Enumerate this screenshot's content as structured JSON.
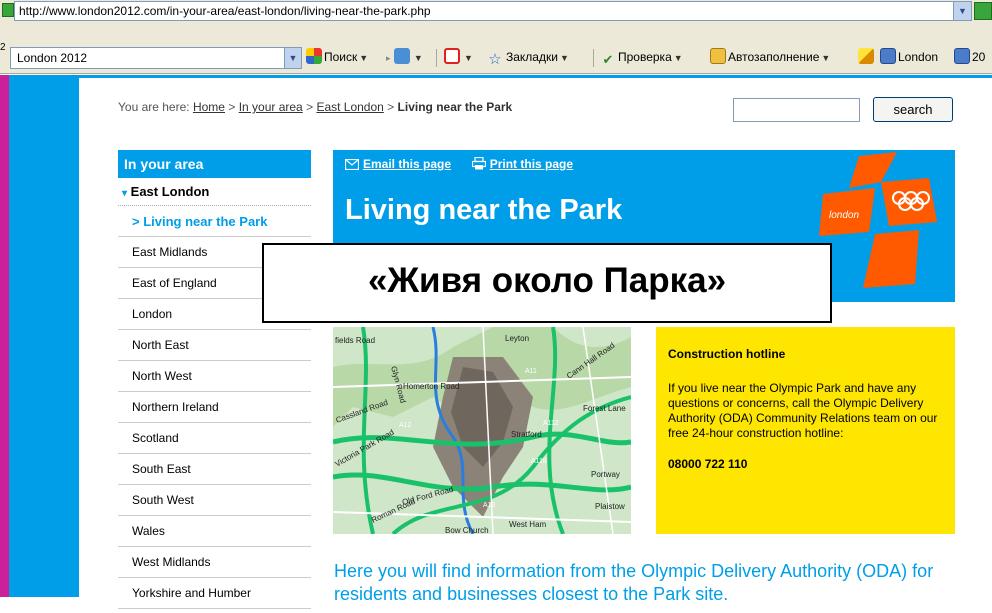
{
  "browser": {
    "address_url": "http://www.london2012.com/in-your-area/east-london/living-near-the-park.php",
    "toolbar_number": "2",
    "toolbar_search_value": "London 2012",
    "toolbar": {
      "search_label": "Поиск",
      "bookmarks_label": "Закладки",
      "spellcheck_label": "Проверка",
      "autofill_label": "Автозаполнение",
      "london_label": "London",
      "truncated_label": "20"
    }
  },
  "breadcrumb": {
    "prefix": "You are here:",
    "home": "Home",
    "in_your_area": "In your area",
    "east_london": "East London",
    "current": "Living near the Park",
    "separator": ">"
  },
  "site_search": {
    "button_label": "search",
    "value": ""
  },
  "leftnav": {
    "heading": "In your area",
    "parent": "East London",
    "current": "> Living near the Park",
    "items": [
      "East Midlands",
      "East of England",
      "London",
      "North East",
      "North West",
      "Northern Ireland",
      "Scotland",
      "South East",
      "South West",
      "Wales",
      "West Midlands",
      "Yorkshire and Humber"
    ]
  },
  "header": {
    "email_link": "Email this page",
    "print_link": "Print this page",
    "title": "Living near the Park",
    "logo_text": "london"
  },
  "overlay": {
    "caption": "«Живя около Парка»"
  },
  "map": {
    "labels": [
      "fields Road",
      "Glyn Road",
      "Homerton Road",
      "Leyton",
      "Cann Hall Road",
      "Forest Lane",
      "Cassland Road",
      "A12",
      "A11",
      "A112",
      "A118",
      "Stratford",
      "Portway",
      "Plaistow",
      "Old Ford Road",
      "Roman Road",
      "West Ham",
      "Victoria Park Road",
      "Bow Church",
      "A13"
    ]
  },
  "hotline": {
    "title": "Construction hotline",
    "body": "If you live near the Olympic Park and have any questions or concerns, call the Olympic Delivery Authority (ODA) Community Relations team on our free 24-hour construction hotline:",
    "phone": "08000 722 110"
  },
  "intro": {
    "text": "Here you will find information from the Olympic Delivery Authority (ODA) for residents and businesses closest to the Park site."
  },
  "colors": {
    "brand_blue": "#009ee8",
    "hotline_yellow": "#ffe600",
    "logo_orange": "#ff5a00",
    "magenta_strip": "#cc1f9a"
  }
}
